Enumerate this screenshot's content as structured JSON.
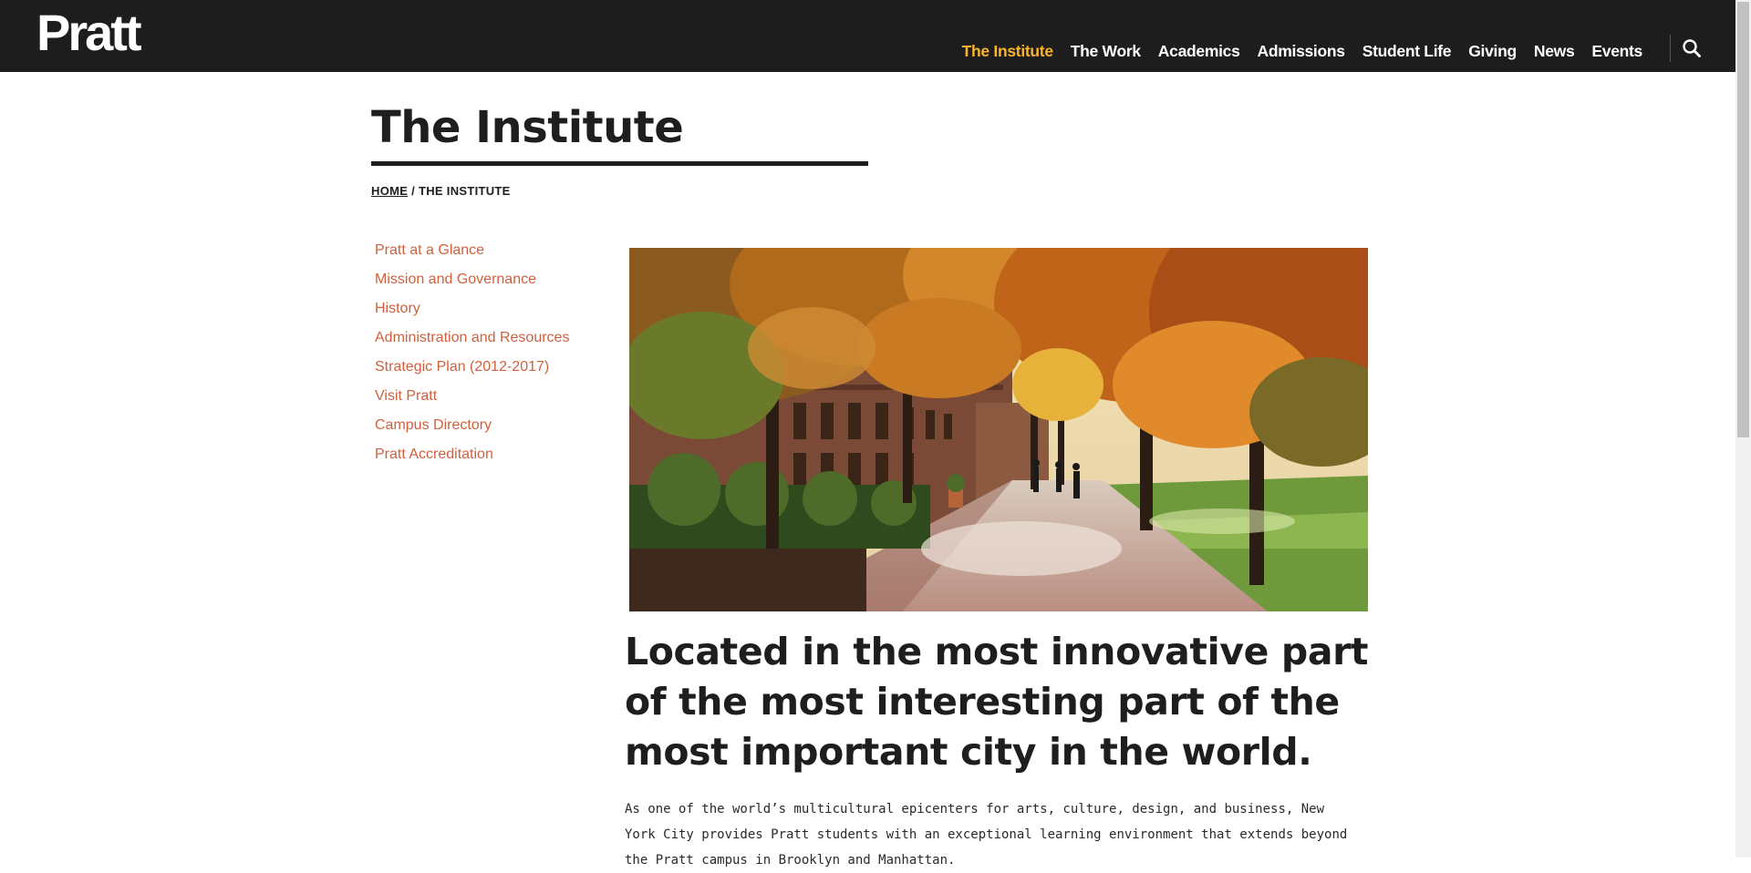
{
  "header": {
    "logo_text": "Pratt",
    "nav": [
      {
        "label": "The Institute",
        "active": true
      },
      {
        "label": "The Work"
      },
      {
        "label": "Academics"
      },
      {
        "label": "Admissions"
      },
      {
        "label": "Student Life"
      },
      {
        "label": "Giving"
      },
      {
        "label": "News"
      },
      {
        "label": "Events"
      }
    ],
    "search_icon": "search-icon"
  },
  "page": {
    "title": "The Institute",
    "breadcrumb": {
      "home": "HOME",
      "separator": "/",
      "current": "THE INSTITUTE"
    }
  },
  "sidebar": {
    "items": [
      {
        "label": "Pratt at a Glance"
      },
      {
        "label": "Mission and Governance"
      },
      {
        "label": "History"
      },
      {
        "label": "Administration and Resources"
      },
      {
        "label": "Strategic Plan (2012-2017)"
      },
      {
        "label": "Visit Pratt"
      },
      {
        "label": "Campus Directory"
      },
      {
        "label": "Pratt Accreditation"
      }
    ]
  },
  "main": {
    "hero_image": "campus-autumn-walkway-photo",
    "lead": "Located in the most innovative part of the most interesting part of the most important city in the world.",
    "body": "As one of the world’s multicultural epicenters for arts, culture, design, and business, New York City provides Pratt students with an exceptional learning environment that extends beyond the Pratt campus in Brooklyn and Manhattan."
  },
  "colors": {
    "header_bg": "#1d1d1d",
    "nav_active": "#f8b52c",
    "sidebar_link": "#d0603d",
    "text": "#1e1e1e"
  }
}
